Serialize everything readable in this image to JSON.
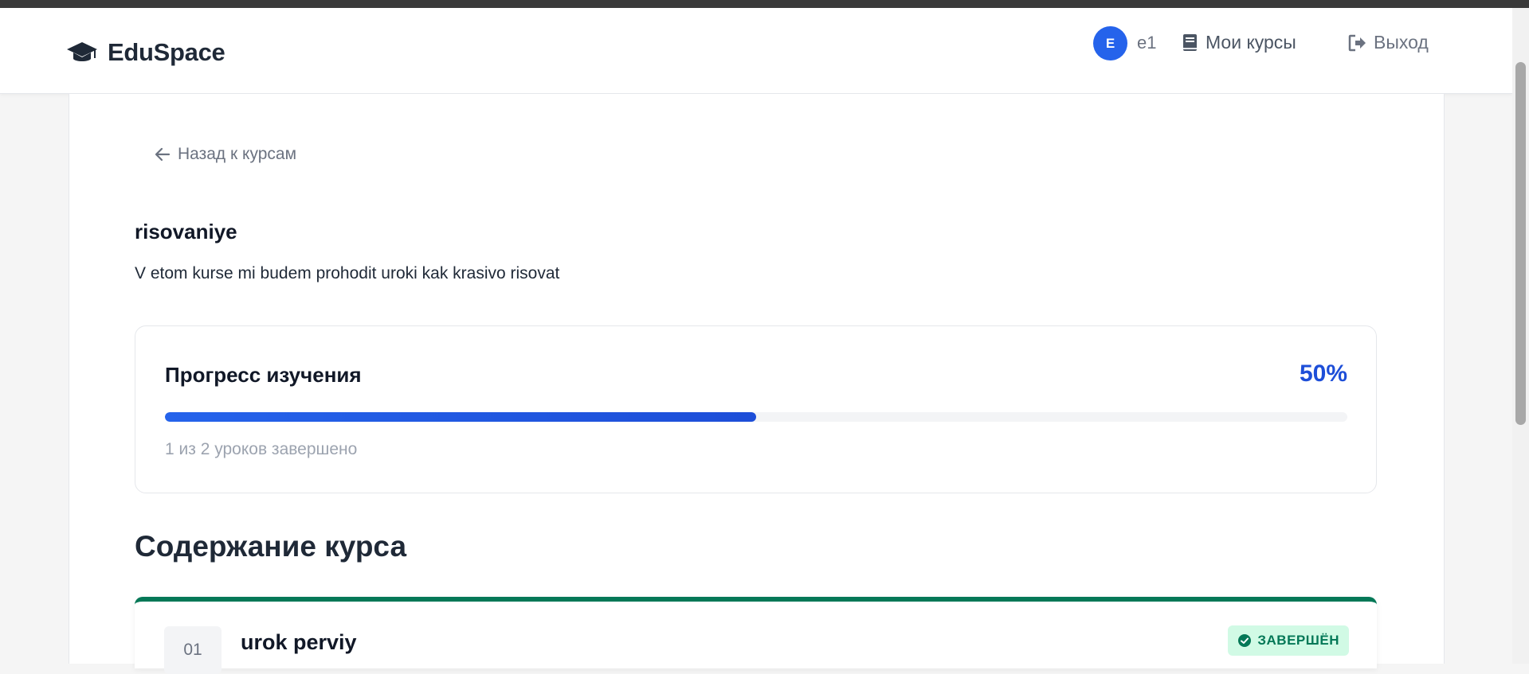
{
  "header": {
    "brand": "EduSpace",
    "user_initial": "E",
    "username": "e1",
    "nav_courses": "Мои курсы",
    "nav_exit": "Выход"
  },
  "course": {
    "back_label": "Назад к курсам",
    "title": "risovaniye",
    "description": "V etom kurse mi budem prohodit uroki kak krasivo risovat"
  },
  "progress": {
    "label": "Прогресс изучения",
    "percent_text": "50%",
    "fraction": 0.5,
    "summary": "1 из 2 уроков завершено"
  },
  "contents": {
    "heading": "Содержание курса",
    "lessons": [
      {
        "number": "01",
        "title": "urok perviy",
        "status": "ЗАВЕРШЁН"
      }
    ]
  },
  "colors": {
    "accent": "#2563eb",
    "completed": "#047857",
    "completed_bg": "#d1fae5"
  }
}
